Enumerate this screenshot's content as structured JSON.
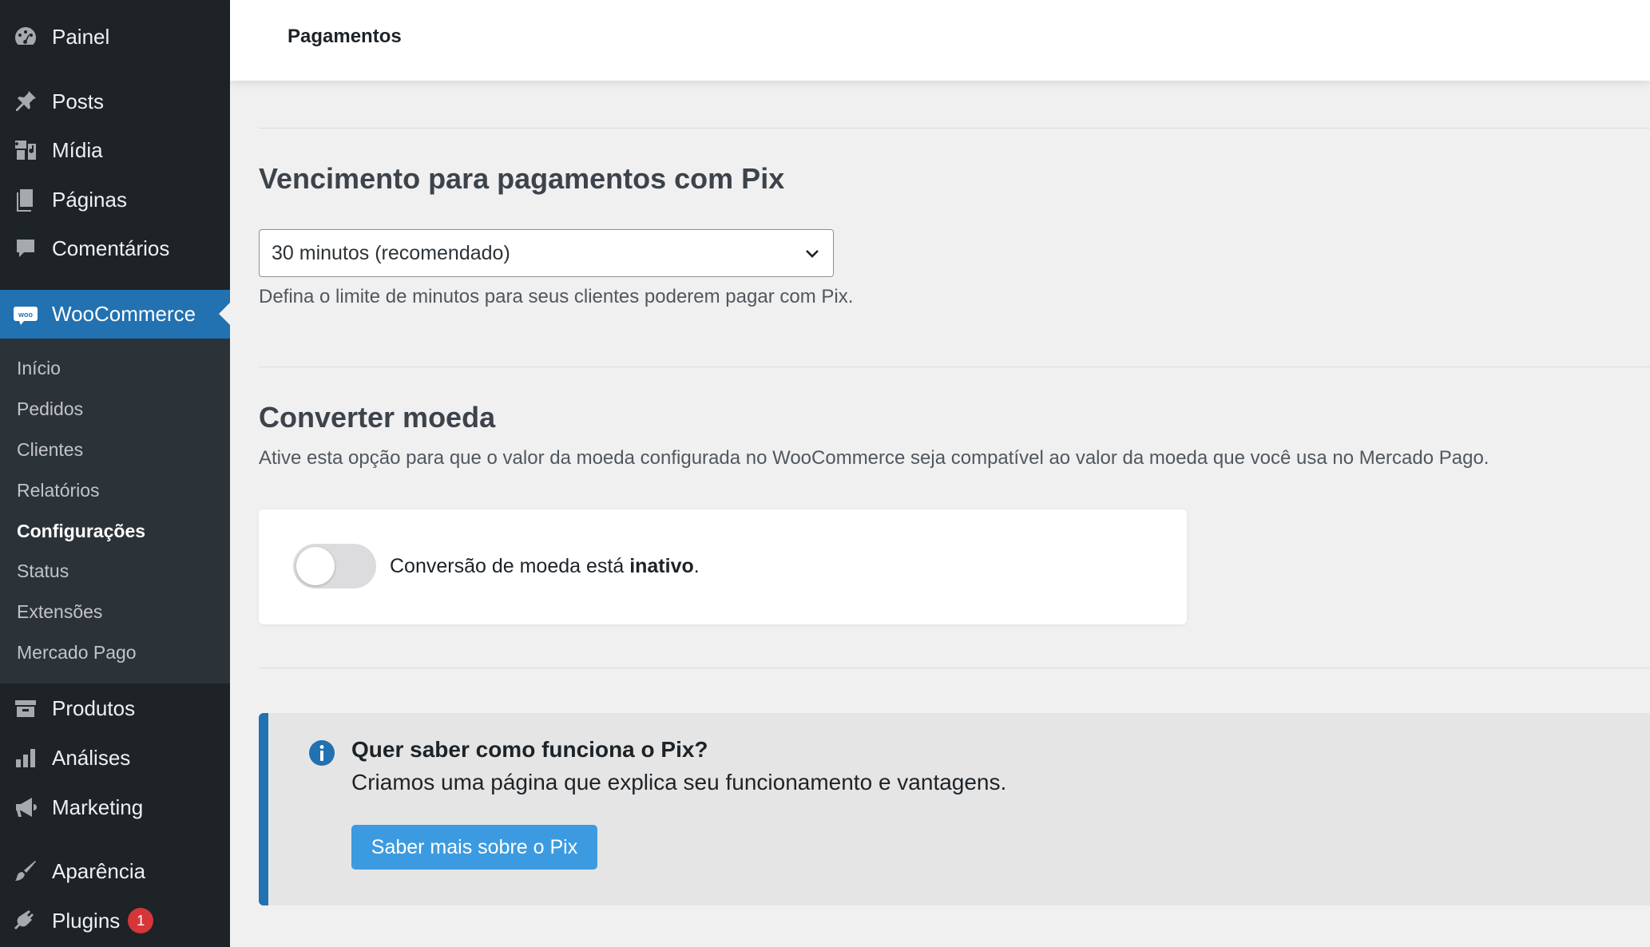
{
  "sidebar": {
    "top_items": [
      {
        "label": "Painel",
        "icon": "dashboard-icon"
      },
      {
        "label": "Posts",
        "icon": "pin-icon"
      },
      {
        "label": "Mídia",
        "icon": "media-icon"
      },
      {
        "label": "Páginas",
        "icon": "pages-icon"
      },
      {
        "label": "Comentários",
        "icon": "comments-icon"
      }
    ],
    "woocommerce": {
      "label": "WooCommerce",
      "icon_text": "woo"
    },
    "submenu": [
      "Início",
      "Pedidos",
      "Clientes",
      "Relatórios",
      "Configurações",
      "Status",
      "Extensões",
      "Mercado Pago"
    ],
    "current_submenu": "Configurações",
    "bottom_items": [
      {
        "label": "Produtos",
        "icon": "archive-icon"
      },
      {
        "label": "Análises",
        "icon": "bar-chart-icon"
      },
      {
        "label": "Marketing",
        "icon": "megaphone-icon"
      },
      {
        "label": "Aparência",
        "icon": "brush-icon"
      },
      {
        "label": "Plugins",
        "icon": "plug-icon",
        "badge": "1"
      }
    ]
  },
  "header": {
    "title": "Pagamentos"
  },
  "pix_expiration": {
    "heading": "Vencimento para pagamentos com Pix",
    "selected": "30 minutos (recomendado)",
    "description": "Defina o limite de minutos para seus clientes poderem pagar com Pix."
  },
  "currency": {
    "heading": "Converter moeda",
    "description": "Ative esta opção para que o valor da moeda configurada no WooCommerce seja compatível ao valor da moeda que você usa no Mercado Pago.",
    "toggle_label_prefix": "Conversão de moeda está ",
    "toggle_state": "inativo",
    "toggle_label_suffix": "."
  },
  "notice": {
    "title": "Quer saber como funciona o Pix?",
    "text": "Criamos uma página que explica seu funcionamento e vantagens.",
    "button": "Saber mais sobre o Pix"
  },
  "colors": {
    "accent": "#2271b1",
    "button": "#3c9be0",
    "sidebar": "#1d2327",
    "badge": "#d63638"
  }
}
